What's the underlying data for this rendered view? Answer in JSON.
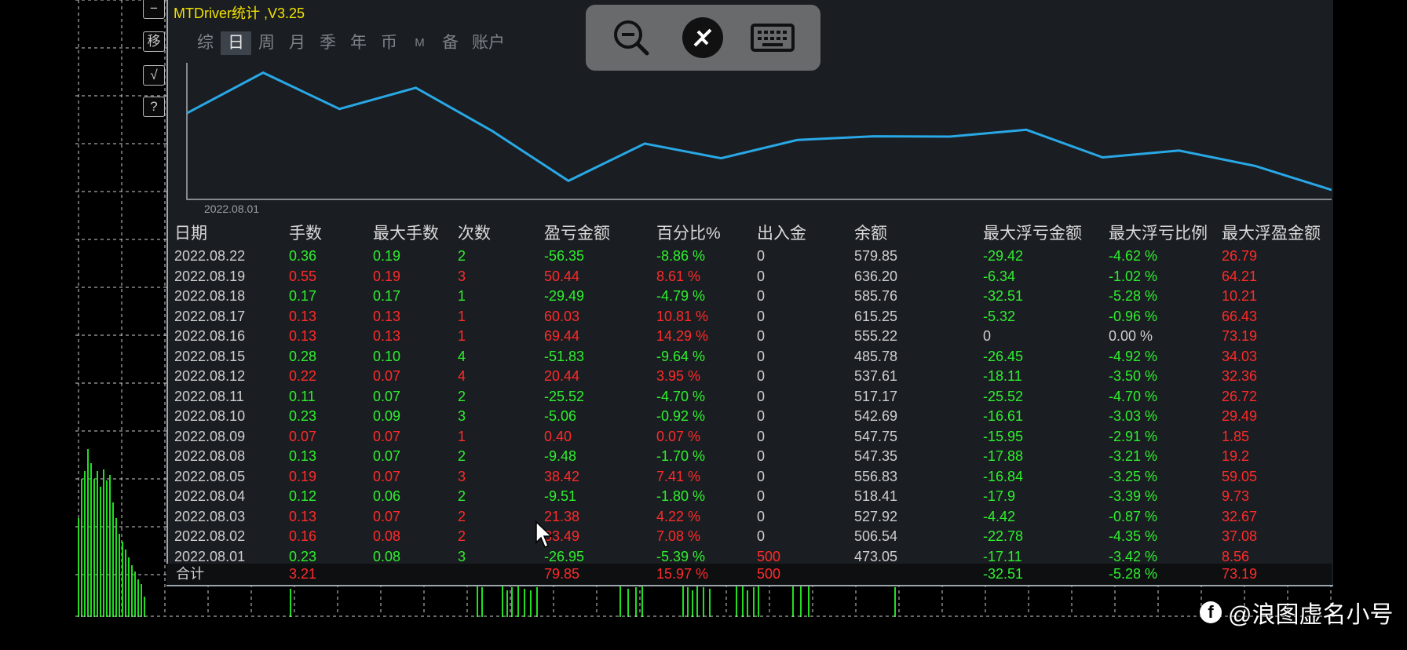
{
  "app": {
    "title": "MTDriver统计 ,V3.25"
  },
  "side_buttons": [
    "−",
    "移",
    "√",
    "?"
  ],
  "tabs": [
    {
      "label": "综",
      "active": false
    },
    {
      "label": "日",
      "active": true
    },
    {
      "label": "周",
      "active": false
    },
    {
      "label": "月",
      "active": false
    },
    {
      "label": "季",
      "active": false
    },
    {
      "label": "年",
      "active": false
    },
    {
      "label": "币",
      "active": false
    },
    {
      "label": "M",
      "active": false
    },
    {
      "label": "备",
      "active": false
    },
    {
      "label": "账户",
      "active": false
    }
  ],
  "chart_data": {
    "type": "line",
    "x_start_label": "2022.08.01",
    "values": [
      473.05,
      506.54,
      527.92,
      518.41,
      556.83,
      547.35,
      547.75,
      542.69,
      517.17,
      537.61,
      485.78,
      555.22,
      615.25,
      585.76,
      636.2,
      579.85
    ],
    "color": "#29a8e6"
  },
  "table": {
    "headers": [
      "日期",
      "手数",
      "最大手数",
      "次数",
      "盈亏金额",
      "百分比%",
      "出入金",
      "余额",
      "最大浮亏金额",
      "最大浮亏比例",
      "最大浮盈金额"
    ],
    "rows": [
      {
        "sign": "g",
        "cells": [
          "2022.08.22",
          "0.36",
          "0.19",
          "2",
          "-56.35",
          "-8.86 %",
          "0",
          "579.85",
          "-29.42",
          "-4.62 %",
          "26.79"
        ]
      },
      {
        "sign": "r",
        "cells": [
          "2022.08.19",
          "0.55",
          "0.19",
          "3",
          "50.44",
          "8.61 %",
          "0",
          "636.20",
          "-6.34",
          "-1.02 %",
          "64.21"
        ]
      },
      {
        "sign": "g",
        "cells": [
          "2022.08.18",
          "0.17",
          "0.17",
          "1",
          "-29.49",
          "-4.79 %",
          "0",
          "585.76",
          "-32.51",
          "-5.28 %",
          "10.21"
        ]
      },
      {
        "sign": "r",
        "cells": [
          "2022.08.17",
          "0.13",
          "0.13",
          "1",
          "60.03",
          "10.81 %",
          "0",
          "615.25",
          "-5.32",
          "-0.96 %",
          "66.43"
        ]
      },
      {
        "sign": "r",
        "cells": [
          "2022.08.16",
          "0.13",
          "0.13",
          "1",
          "69.44",
          "14.29 %",
          "0",
          "555.22",
          "0",
          "0.00 %",
          "73.19"
        ]
      },
      {
        "sign": "g",
        "cells": [
          "2022.08.15",
          "0.28",
          "0.10",
          "4",
          "-51.83",
          "-9.64 %",
          "0",
          "485.78",
          "-26.45",
          "-4.92 %",
          "34.03"
        ]
      },
      {
        "sign": "r",
        "cells": [
          "2022.08.12",
          "0.22",
          "0.07",
          "4",
          "20.44",
          "3.95 %",
          "0",
          "537.61",
          "-18.11",
          "-3.50 %",
          "32.36"
        ]
      },
      {
        "sign": "g",
        "cells": [
          "2022.08.11",
          "0.11",
          "0.07",
          "2",
          "-25.52",
          "-4.70 %",
          "0",
          "517.17",
          "-25.52",
          "-4.70 %",
          "26.72"
        ]
      },
      {
        "sign": "g",
        "cells": [
          "2022.08.10",
          "0.23",
          "0.09",
          "3",
          "-5.06",
          "-0.92 %",
          "0",
          "542.69",
          "-16.61",
          "-3.03 %",
          "29.49"
        ]
      },
      {
        "sign": "r",
        "cells": [
          "2022.08.09",
          "0.07",
          "0.07",
          "1",
          "0.40",
          "0.07 %",
          "0",
          "547.75",
          "-15.95",
          "-2.91 %",
          "1.85"
        ]
      },
      {
        "sign": "g",
        "cells": [
          "2022.08.08",
          "0.13",
          "0.07",
          "2",
          "-9.48",
          "-1.70 %",
          "0",
          "547.35",
          "-17.88",
          "-3.21 %",
          "19.2"
        ]
      },
      {
        "sign": "r",
        "cells": [
          "2022.08.05",
          "0.19",
          "0.07",
          "3",
          "38.42",
          "7.41 %",
          "0",
          "556.83",
          "-16.84",
          "-3.25 %",
          "59.05"
        ]
      },
      {
        "sign": "g",
        "cells": [
          "2022.08.04",
          "0.12",
          "0.06",
          "2",
          "-9.51",
          "-1.80 %",
          "0",
          "518.41",
          "-17.9",
          "-3.39 %",
          "9.73"
        ]
      },
      {
        "sign": "r",
        "cells": [
          "2022.08.03",
          "0.13",
          "0.07",
          "2",
          "21.38",
          "4.22 %",
          "0",
          "527.92",
          "-4.42",
          "-0.87 %",
          "32.67"
        ]
      },
      {
        "sign": "r",
        "cells": [
          "2022.08.02",
          "0.16",
          "0.08",
          "2",
          "33.49",
          "7.08 %",
          "0",
          "506.54",
          "-22.78",
          "-4.35 %",
          "37.08"
        ]
      },
      {
        "sign": "g",
        "cells": [
          "2022.08.01",
          "0.23",
          "0.08",
          "3",
          "-26.95",
          "-5.39 %",
          "500",
          "473.05",
          "-17.11",
          "-3.42 %",
          "8.56"
        ]
      }
    ],
    "total": {
      "label": "合计",
      "lots": "3.21",
      "pnl": "79.85",
      "pct": "15.97 %",
      "deposit": "500",
      "max_float_loss": "-32.51",
      "max_float_loss_pct": "-5.28 %",
      "max_float_profit": "73.19"
    }
  },
  "toolbar": {
    "icons": [
      "zoom-out-icon",
      "remote-disconnect-icon",
      "keyboard-icon"
    ]
  },
  "watermark": {
    "text": "@浪图虚名小号"
  }
}
